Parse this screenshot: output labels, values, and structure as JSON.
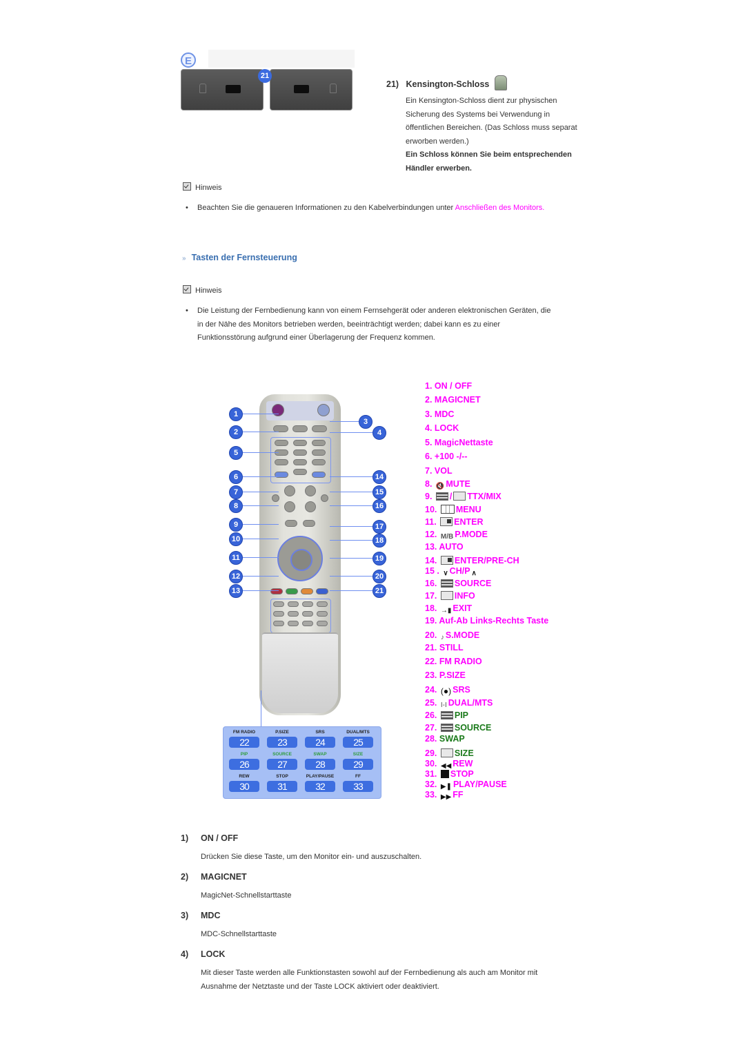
{
  "kensington": {
    "badge_letter": "E",
    "callout_number": "21",
    "heading_number": "21)",
    "heading": "Kensington-Schloss",
    "body_lines": [
      "Ein Kensington-Schloss dient zur physischen",
      "Sicherung des Systems bei Verwendung in",
      "öffentlichen Bereichen. (Das Schloss muss separat",
      "erworben werden.)"
    ],
    "bold_lines": [
      "Ein Schloss können Sie beim entsprechenden",
      "Händler erwerben."
    ]
  },
  "note1": {
    "label": "Hinweis",
    "bullet_text": "Beachten Sie die genaueren Informationen zu den Kabelverbindungen unter ",
    "link_text": "Anschließen des Monitors."
  },
  "section": {
    "arrow": "»",
    "title": "Tasten der Fernsteuerung"
  },
  "note2": {
    "label": "Hinweis",
    "bullet_lines": [
      "Die Leistung der Fernbedienung kann von einem Fernsehgerät oder anderen elektronischen Geräten, die",
      "in der Nähe des Monitors betrieben werden, beeinträchtigt werden; dabei kann es zu einer",
      "Funktionsstörung aufgrund einer Überlagerung der Frequenz kommen."
    ]
  },
  "remote": {
    "callouts_left": [
      "1",
      "2",
      "5",
      "6",
      "7",
      "8",
      "9",
      "10",
      "11",
      "12",
      "13"
    ],
    "callouts_right": [
      "3",
      "4",
      "14",
      "15",
      "16",
      "17",
      "18",
      "19",
      "20",
      "21"
    ],
    "keypad": [
      {
        "caption": "FM RADIO",
        "key": "22",
        "green": false
      },
      {
        "caption": "P.SIZE",
        "key": "23",
        "green": false
      },
      {
        "caption": "SRS",
        "key": "24",
        "green": false
      },
      {
        "caption": "DUAL/MTS",
        "key": "25",
        "green": false
      },
      {
        "caption": "PIP",
        "key": "26",
        "green": true
      },
      {
        "caption": "SOURCE",
        "key": "27",
        "green": true
      },
      {
        "caption": "SWAP",
        "key": "28",
        "green": true
      },
      {
        "caption": "SIZE",
        "key": "29",
        "green": true
      },
      {
        "caption": "REW",
        "key": "30",
        "green": false
      },
      {
        "caption": "STOP",
        "key": "31",
        "green": false
      },
      {
        "caption": "PLAY/PAUSE",
        "key": "32",
        "green": false
      },
      {
        "caption": "FF",
        "key": "33",
        "green": false
      }
    ]
  },
  "key_list": [
    {
      "num": "1.",
      "icon": "",
      "label": "ON / OFF",
      "color": "#ff00ff"
    },
    {
      "num": "2.",
      "icon": "",
      "label": "MAGICNET",
      "color": "#ff00ff"
    },
    {
      "num": "3.",
      "icon": "",
      "label": "MDC",
      "color": "#ff00ff"
    },
    {
      "num": "4.",
      "icon": "",
      "label": "LOCK",
      "color": "#ff00ff"
    },
    {
      "num": "5.",
      "icon": "",
      "label": "MagicNettaste",
      "color": "#ff00ff"
    },
    {
      "num": "6.",
      "icon": "",
      "label": "+100 -/--",
      "color": "#ff00ff"
    },
    {
      "num": "7.",
      "icon": "",
      "label": "VOL",
      "color": "#ff00ff"
    },
    {
      "num": "8.",
      "icon": "mute-icon",
      "label": "MUTE",
      "color": "#ff00ff"
    },
    {
      "num": "9.",
      "icon": "ttx-mix-icon",
      "label": "TTX/MIX",
      "color": "#ff00ff"
    },
    {
      "num": "10.",
      "icon": "menu-icon",
      "label": "MENU",
      "color": "#ff00ff"
    },
    {
      "num": "11.",
      "icon": "enter-icon",
      "label": "ENTER",
      "color": "#ff00ff"
    },
    {
      "num": "12.",
      "icon": "mb-icon",
      "label": "P.MODE",
      "color": "#ff00ff"
    },
    {
      "num": "13.",
      "icon": "",
      "label": "AUTO",
      "color": "#ff00ff"
    },
    {
      "num": "14.",
      "icon": "pre-ch-icon",
      "label": "ENTER/PRE-CH",
      "color": "#ff00ff"
    },
    {
      "num": "15 .",
      "icon": "chevron-down-icon",
      "label": "CH/P",
      "color": "#ff00ff"
    },
    {
      "num": "16.",
      "icon": "source-icon",
      "label": "SOURCE",
      "color": "#ff00ff"
    },
    {
      "num": "17.",
      "icon": "info-icon",
      "label": "INFO",
      "color": "#ff00ff"
    },
    {
      "num": "18.",
      "icon": "exit-icon",
      "label": "EXIT",
      "color": "#ff00ff"
    },
    {
      "num": "19.",
      "icon": "",
      "label": "Auf-Ab Links-Rechts Taste",
      "color": "#ff00ff"
    },
    {
      "num": "20.",
      "icon": "smode-icon",
      "label": "S.MODE",
      "color": "#ff00ff"
    },
    {
      "num": "21.",
      "icon": "",
      "label": "STILL",
      "color": "#ff00ff"
    },
    {
      "num": "22.",
      "icon": "",
      "label": "FM RADIO",
      "color": "#ff00ff"
    },
    {
      "num": "23.",
      "icon": "",
      "label": "P.SIZE",
      "color": "#ff00ff"
    },
    {
      "num": "24.",
      "icon": "srs-icon",
      "label": "SRS",
      "color": "#ff00ff"
    },
    {
      "num": "25.",
      "icon": "dual-icon",
      "label": "DUAL/MTS",
      "color": "#ff00ff"
    },
    {
      "num": "26.",
      "icon": "pip-icon",
      "label": "PIP",
      "color": "#1b7a1b"
    },
    {
      "num": "27.",
      "icon": "source-icon",
      "label": "SOURCE",
      "color": "#1b7a1b"
    },
    {
      "num": "28.",
      "icon": "",
      "label": "SWAP",
      "color": "#1b7a1b"
    },
    {
      "num": "29.",
      "icon": "size-icon",
      "label": "SIZE",
      "color": "#1b7a1b"
    },
    {
      "num": "30.",
      "icon": "rewind-icon",
      "label": "REW",
      "color": "#ff00ff"
    },
    {
      "num": "31.",
      "icon": "stop-icon",
      "label": "STOP",
      "color": "#ff00ff"
    },
    {
      "num": "32.",
      "icon": "play-pause-icon",
      "label": "PLAY/PAUSE",
      "color": "#ff00ff"
    },
    {
      "num": "33.",
      "icon": "fast-forward-icon",
      "label": "FF",
      "color": "#ff00ff"
    }
  ],
  "details": [
    {
      "num": "1)",
      "title": "ON / OFF",
      "lines": [
        "Drücken Sie diese Taste, um den Monitor ein- und auszuschalten."
      ]
    },
    {
      "num": "2)",
      "title": "MAGICNET",
      "lines": [
        "MagicNet-Schnellstarttaste"
      ]
    },
    {
      "num": "3)",
      "title": "MDC",
      "lines": [
        "MDC-Schnellstarttaste"
      ]
    },
    {
      "num": "4)",
      "title": "LOCK",
      "lines": [
        "Mit dieser Taste werden alle Funktionstasten sowohl auf der Fernbedienung als auch am Monitor mit",
        "Ausnahme der Netztaste und der Taste LOCK aktiviert oder deaktiviert."
      ]
    }
  ]
}
